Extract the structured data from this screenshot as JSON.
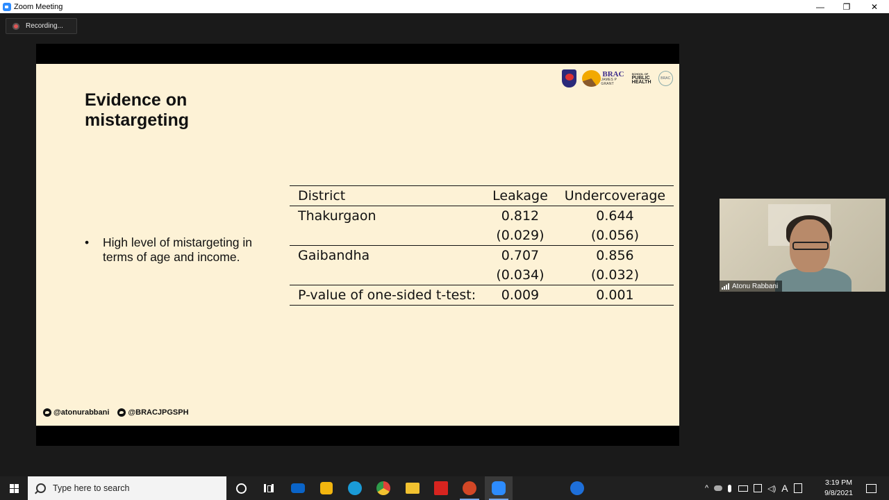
{
  "window": {
    "title": "Zoom Meeting",
    "minimize": "—",
    "maximize": "❐",
    "close": "✕"
  },
  "recording": {
    "label": "Recording..."
  },
  "slide": {
    "title_line1": "Evidence on",
    "title_line2": "mistargeting",
    "logos": {
      "brac": "BRAC",
      "brac_sub": "JAMES P GRANT",
      "school_line1": "SCHOOL OF",
      "school_line2": "PUBLIC",
      "school_line3": "HEALTH",
      "round": "BRAC"
    },
    "bullet": "High level of mistargeting in terms of age and income.",
    "table": {
      "headers": [
        "District",
        "Leakage",
        "Undercoverage"
      ],
      "rows": [
        {
          "district": "Thakurgaon",
          "leakage": "0.812",
          "undercoverage": "0.644",
          "leakage_se": "(0.029)",
          "undercoverage_se": "(0.056)"
        },
        {
          "district": "Gaibandha",
          "leakage": "0.707",
          "undercoverage": "0.856",
          "leakage_se": "(0.034)",
          "undercoverage_se": "(0.032)"
        }
      ],
      "footer": {
        "label": "P-value of one-sided t-test:",
        "leakage": "0.009",
        "undercoverage": "0.001"
      }
    },
    "twitter": [
      "@atonurabbani",
      "@BRACJPGSPH"
    ]
  },
  "video": {
    "participant": "Atonu Rabbani"
  },
  "taskbar": {
    "search_placeholder": "Type here to search",
    "time": "3:19 PM",
    "date": "9/8/2021",
    "tray_letter": "A",
    "colors": {
      "mail": "#0a64c8",
      "store": "#f2b50f",
      "edge": "#1a9bd7",
      "chrome": "#e0433a",
      "explorer": "#f2c230",
      "acrobat": "#d8241f",
      "powerpoint": "#d24726",
      "zoom": "#2d8cff",
      "help": "#1e6fd9"
    }
  }
}
